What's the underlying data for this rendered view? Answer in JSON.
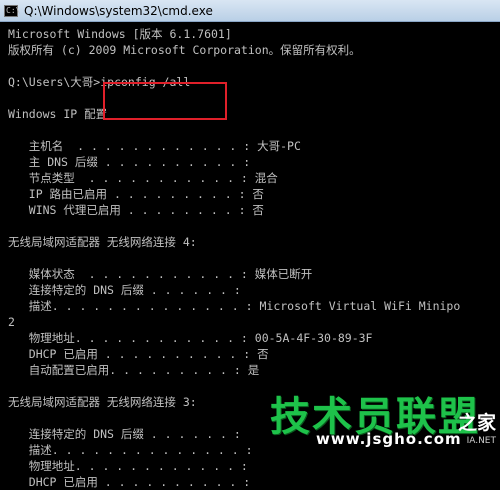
{
  "window": {
    "title": "Q:\\Windows\\system32\\cmd.exe",
    "icon": "cmd-icon",
    "icon_glyph": "C:\\"
  },
  "console": {
    "lines": [
      "Microsoft Windows [版本 6.1.7601]",
      "版权所有 (c) 2009 Microsoft Corporation。保留所有权利。",
      "",
      "Q:\\Users\\大哥>ipconfig /all",
      "",
      "Windows IP 配置",
      "",
      "   主机名  . . . . . . . . . . . . : 大哥-PC",
      "   主 DNS 后缀 . . . . . . . . . . :",
      "   节点类型  . . . . . . . . . . . : 混合",
      "   IP 路由已启用 . . . . . . . . . : 否",
      "   WINS 代理已启用 . . . . . . . . : 否",
      "",
      "无线局域网适配器 无线网络连接 4:",
      "",
      "   媒体状态  . . . . . . . . . . . : 媒体已断开",
      "   连接特定的 DNS 后缀 . . . . . . :",
      "   描述. . . . . . . . . . . . . . : Microsoft Virtual WiFi Minipo",
      "2",
      "   物理地址. . . . . . . . . . . . : 00-5A-4F-30-89-3F",
      "   DHCP 已启用 . . . . . . . . . . : 否",
      "   自动配置已启用. . . . . . . . . : 是",
      "",
      "无线局域网适配器 无线网络连接 3:",
      "",
      "   连接特定的 DNS 后缀 . . . . . . :",
      "   描述. . . . . . . . . . . . . . :",
      "   物理地址. . . . . . . . . . . . :",
      "   DHCP 已启用 . . . . . . . . . . :"
    ]
  },
  "highlight_color": "#e0202a",
  "watermark": {
    "main": "技术员联盟",
    "side": "之家",
    "url": "www.jsgho.com",
    "small": "IA.NET"
  }
}
